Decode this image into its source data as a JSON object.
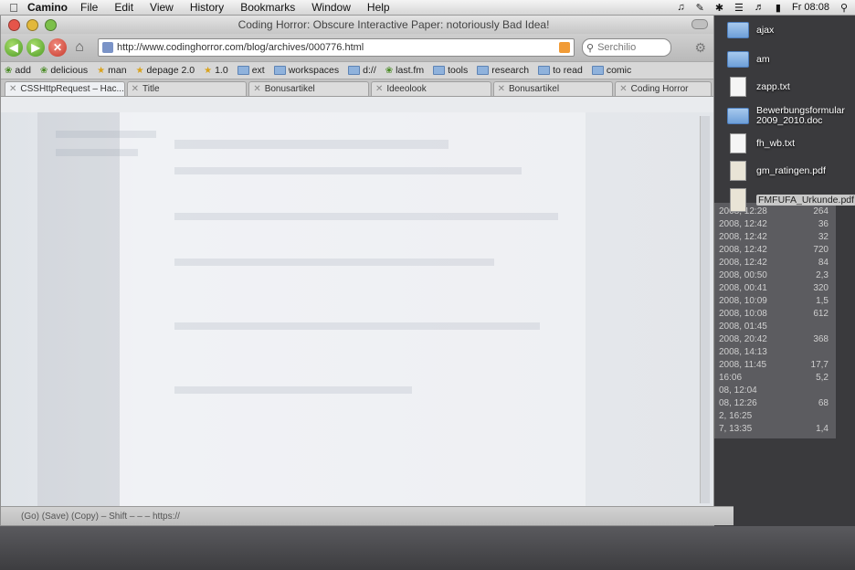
{
  "menubar": {
    "app_name": "Camino",
    "menus": [
      "File",
      "Edit",
      "View",
      "History",
      "Bookmarks",
      "Window",
      "Help"
    ],
    "clock": "Fr 08:08"
  },
  "browser": {
    "window_title": "Coding Horror: Obscure Interactive Paper: notoriously Bad Idea!",
    "url": "http://www.codinghorror.com/blog/archives/000776.html",
    "search_placeholder": "Serchilio",
    "bookmarks": [
      {
        "label": "add",
        "icon": "leaf-icon"
      },
      {
        "label": "delicious",
        "icon": "leaf-icon"
      },
      {
        "label": "man",
        "icon": "star-icon"
      },
      {
        "label": "depage 2.0",
        "icon": "star-icon"
      },
      {
        "label": "1.0",
        "icon": "star-icon"
      },
      {
        "label": "ext",
        "icon": "folder-icon"
      },
      {
        "label": "workspaces",
        "icon": "folder-icon"
      },
      {
        "label": "d://",
        "icon": "folder-icon"
      },
      {
        "label": "last.fm",
        "icon": "leaf-icon"
      },
      {
        "label": "tools",
        "icon": "folder-icon"
      },
      {
        "label": "research",
        "icon": "folder-icon"
      },
      {
        "label": "to read",
        "icon": "folder-icon"
      },
      {
        "label": "comic",
        "icon": "folder-icon"
      }
    ],
    "tabs": [
      {
        "label": "CSSHttpRequest – Hac..."
      },
      {
        "label": "Title"
      },
      {
        "label": "Bonusartikel"
      },
      {
        "label": "Ideeolook"
      },
      {
        "label": "Bonusartikel"
      },
      {
        "label": "Coding Horror"
      }
    ],
    "status_text": "(Go) (Save) (Copy) – Shift – – – https://"
  },
  "desktop": {
    "items": [
      {
        "label": "ajax",
        "kind": "folder"
      },
      {
        "label": "am",
        "kind": "folder"
      },
      {
        "label": "zapp.txt",
        "kind": "doc"
      },
      {
        "label": "Bewerbungsformular 2009_2010.doc",
        "kind": "folder"
      },
      {
        "label": "fh_wb.txt",
        "kind": "doc"
      },
      {
        "label": "gm_ratingen.pdf",
        "kind": "pdf"
      },
      {
        "label": "FMFUFA_Urkunde.pdf",
        "kind": "pdf",
        "selected": true
      }
    ]
  },
  "list_panel": {
    "rows": [
      {
        "date": "2008, 12:28",
        "size": "264"
      },
      {
        "date": "2008, 12:42",
        "size": "36"
      },
      {
        "date": "2008, 12:42",
        "size": "32"
      },
      {
        "date": "2008, 12:42",
        "size": "720"
      },
      {
        "date": "2008, 12:42",
        "size": "84"
      },
      {
        "date": "2008, 00:50",
        "size": "2,3"
      },
      {
        "date": "2008, 00:41",
        "size": "320"
      },
      {
        "date": "2008, 10:09",
        "size": "1,5"
      },
      {
        "date": "2008, 10:08",
        "size": "612"
      },
      {
        "date": "2008, 01:45",
        "size": ""
      },
      {
        "date": "2008, 20:42",
        "size": "368"
      },
      {
        "date": "2008, 14:13",
        "size": ""
      },
      {
        "date": "2008, 11:45",
        "size": "17,7"
      },
      {
        "date": "16:06",
        "size": "5,2"
      },
      {
        "date": "08, 12:04",
        "size": ""
      },
      {
        "date": "08, 12:26",
        "size": "68"
      },
      {
        "date": "2, 16:25",
        "size": ""
      },
      {
        "date": "7, 13:35",
        "size": "1,4"
      }
    ]
  }
}
